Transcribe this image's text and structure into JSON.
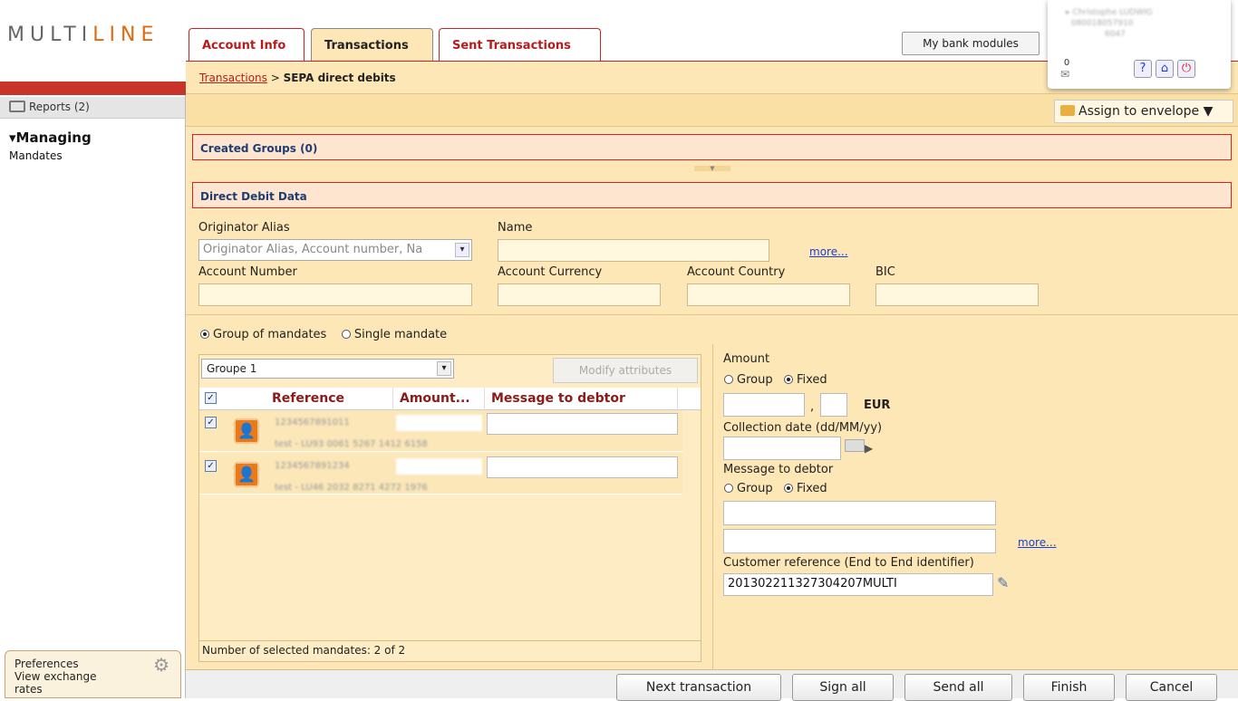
{
  "brand": {
    "logo_part1": "MULTI",
    "logo_part2": "LINE"
  },
  "sidebar": {
    "reports": "Reports (2)",
    "section": "Managing",
    "item": "Mandates",
    "preferences": "Preferences",
    "exchange": "View exchange rates"
  },
  "tabs": [
    "Account Info",
    "Transactions",
    "Sent Transactions"
  ],
  "header": {
    "bank_modules": "My bank modules",
    "mail_count": "0"
  },
  "breadcrumb": {
    "link": "Transactions",
    "sep": " > ",
    "current": "SEPA direct debits"
  },
  "toolbar": {
    "assign": "Assign to envelope"
  },
  "sections": {
    "created": "Created Groups (0)",
    "debit": "Direct Debit Data"
  },
  "form": {
    "originator_label": "Originator Alias",
    "originator_placeholder": "Originator Alias, Account number, Na",
    "name_label": "Name",
    "more": "more...",
    "account_number": "Account Number",
    "account_currency": "Account Currency",
    "account_country": "Account Country",
    "bic": "BIC"
  },
  "mode": {
    "group": "Group of mandates",
    "single": "Single mandate",
    "selected": "group"
  },
  "group": {
    "select_value": "Groupe 1",
    "modify": "Modify attributes",
    "columns": [
      "Reference",
      "Amount...",
      "Message to debtor"
    ],
    "footer": "Number of selected mandates: 2 of 2"
  },
  "right": {
    "amount_label": "Amount",
    "opt_group": "Group",
    "opt_fixed": "Fixed",
    "comma": ",",
    "currency": "EUR",
    "collection_label": "Collection date (dd/MM/yy)",
    "message_label": "Message to debtor",
    "more": "more...",
    "customer_ref_label": "Customer reference (End to End identifier)",
    "customer_ref_value": "201302211327304207MULTI"
  },
  "buttons": {
    "next": "Next transaction",
    "sign": "Sign all",
    "send": "Send all",
    "finish": "Finish",
    "cancel": "Cancel"
  }
}
